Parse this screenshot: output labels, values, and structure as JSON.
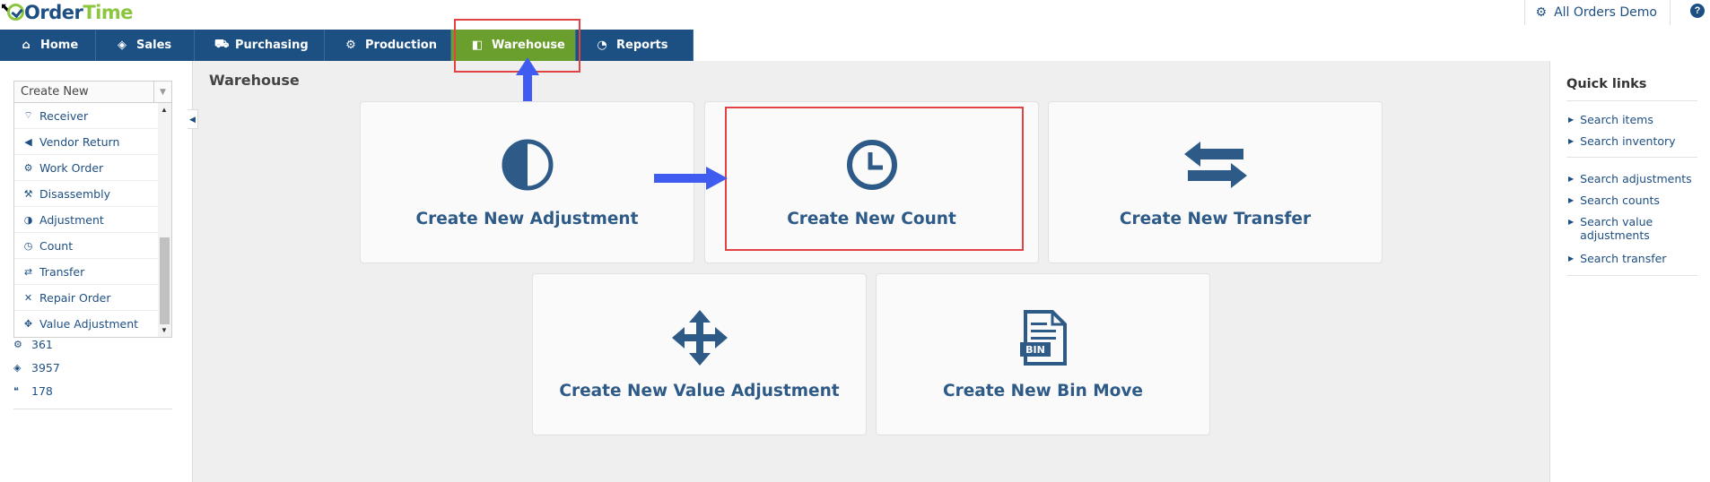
{
  "header": {
    "logo_order": "Order",
    "logo_time": "Time",
    "account_label": "All Orders Demo",
    "help_label": "?"
  },
  "nav": {
    "items": [
      {
        "label": "Home",
        "icon": "home-icon"
      },
      {
        "label": "Sales",
        "icon": "tag-icon"
      },
      {
        "label": "Purchasing",
        "icon": "cart-icon"
      },
      {
        "label": "Production",
        "icon": "cogs-icon"
      },
      {
        "label": "Warehouse",
        "icon": "cube-icon",
        "active": true
      },
      {
        "label": "Reports",
        "icon": "pie-chart-icon"
      }
    ],
    "active_color": "#6a9f2e",
    "bar_color": "#1c4f82"
  },
  "left": {
    "select_value": "Create New",
    "dropdown_items": [
      {
        "label": "Receiver",
        "icon": "wifi-icon"
      },
      {
        "label": "Vendor Return",
        "icon": "return-icon"
      },
      {
        "label": "Work Order",
        "icon": "gear-icon"
      },
      {
        "label": "Disassembly",
        "icon": "hammer-icon"
      },
      {
        "label": "Adjustment",
        "icon": "contrast-icon"
      },
      {
        "label": "Count",
        "icon": "clock-icon"
      },
      {
        "label": "Transfer",
        "icon": "exchange-icon"
      },
      {
        "label": "Repair Order",
        "icon": "wrench-icon"
      },
      {
        "label": "Value Adjustment",
        "icon": "move-icon"
      }
    ],
    "stats": [
      {
        "value": "361",
        "icon": "gear-icon"
      },
      {
        "value": "3957",
        "icon": "tag-icon"
      },
      {
        "value": "178",
        "icon": "quote-icon"
      }
    ]
  },
  "main": {
    "title": "Warehouse",
    "cards": [
      {
        "label": "Create New Adjustment",
        "icon": "contrast-icon"
      },
      {
        "label": "Create New Count",
        "icon": "clock-icon"
      },
      {
        "label": "Create New Transfer",
        "icon": "exchange-icon"
      },
      {
        "label": "Create New Value Adjustment",
        "icon": "move-icon"
      },
      {
        "label": "Create New Bin Move",
        "icon": "bin-document-icon",
        "icon_text": "BIN"
      }
    ]
  },
  "quick_links": {
    "title": "Quick links",
    "groups": [
      [
        "Search items",
        "Search inventory"
      ],
      [
        "Search adjustments",
        "Search counts",
        "Search value adjustments",
        "Search transfer"
      ]
    ]
  },
  "colors": {
    "brand_blue": "#1e4f82",
    "brand_green": "#8cc63f",
    "highlight_red": "#e14345",
    "annotation_arrow": "#3f5bf0"
  }
}
